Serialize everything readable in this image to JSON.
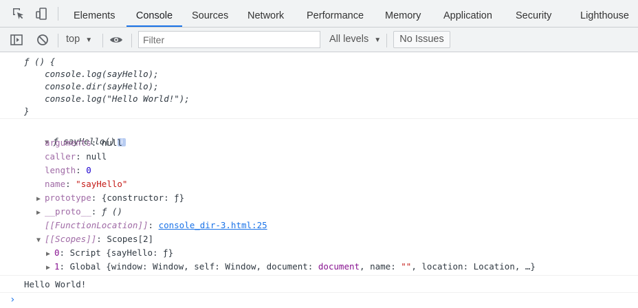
{
  "tabs": {
    "items": [
      "Elements",
      "Console",
      "Sources",
      "Network",
      "Performance",
      "Memory",
      "Application",
      "Security",
      "Lighthouse"
    ],
    "active": "Console"
  },
  "toolbar": {
    "context": "top",
    "filter_placeholder": "Filter",
    "levels": "All levels",
    "issues": "No Issues"
  },
  "console": {
    "func_source": {
      "line1": "ƒ () {",
      "line2": "    console.log(sayHello);",
      "line3": "    console.dir(sayHello);",
      "line4": "    console.log(\"Hello World!\");",
      "line5": "}"
    },
    "dir": {
      "header": "ƒ sayHello()",
      "info_badge": "i",
      "arguments_key": "arguments",
      "arguments_val": "null",
      "caller_key": "caller",
      "caller_val": "null",
      "length_key": "length",
      "length_val": "0",
      "name_key": "name",
      "name_val": "\"sayHello\"",
      "prototype_key": "prototype",
      "prototype_val": "{constructor: ƒ}",
      "proto_key": "__proto__",
      "proto_val": "ƒ ()",
      "location_key": "[[FunctionLocation]]",
      "location_val": "console_dir-3.html:25",
      "scopes_key": "[[Scopes]]",
      "scopes_val": "Scopes[2]",
      "scope0_key": "0",
      "scope0_val": "Script {sayHello: ƒ}",
      "scope1_key": "1",
      "scope1_pre": "Global {window: Window, self: Window, document: ",
      "scope1_doc": "document",
      "scope1_mid": ", name: ",
      "scope1_str": "\"\"",
      "scope1_post": ", location: Location, …}"
    },
    "log_output": "Hello World!",
    "prompt": "›"
  }
}
